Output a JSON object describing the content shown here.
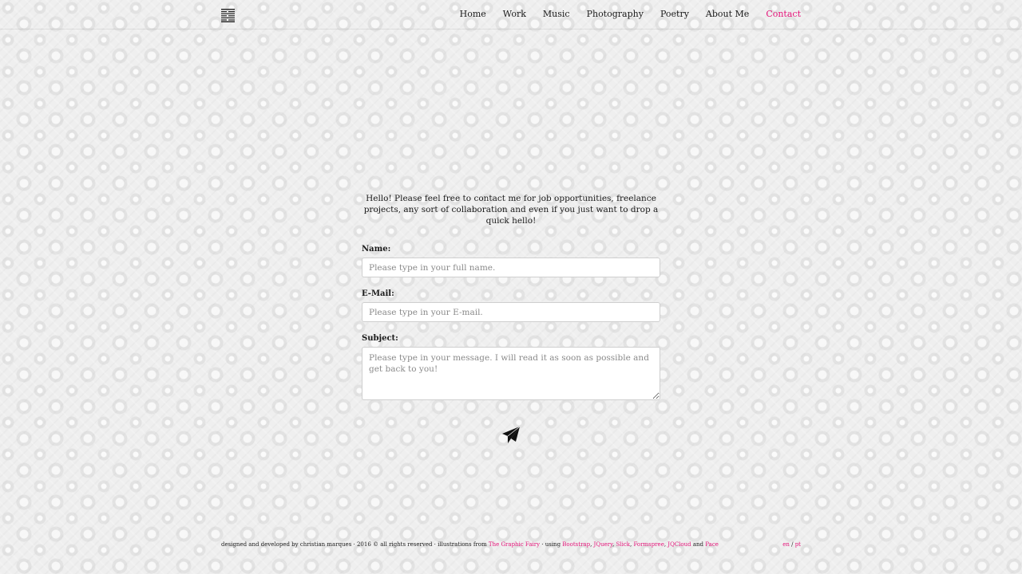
{
  "colors": {
    "accent": "#e5157a",
    "text": "#1a1a1a",
    "background": "#efefef"
  },
  "header": {
    "logo_icon": "menu-lines-logo-icon",
    "nav": [
      {
        "label": "Home",
        "active": false
      },
      {
        "label": "Work",
        "active": false
      },
      {
        "label": "Music",
        "active": false
      },
      {
        "label": "Photography",
        "active": false
      },
      {
        "label": "Poetry",
        "active": false
      },
      {
        "label": "About Me",
        "active": false
      },
      {
        "label": "Contact",
        "active": true
      }
    ]
  },
  "contact": {
    "intro": "Hello! Please feel free to contact me for job opportunities, freelance projects, any sort of collaboration and even if you just want to drop a quick hello!",
    "name_label": "Name:",
    "name_placeholder": "Please type in your full name.",
    "email_label": "E-Mail:",
    "email_placeholder": "Please type in your E-mail.",
    "subject_label": "Subject:",
    "subject_placeholder": "Please type in your message. I will read it as soon as possible and get back to you!",
    "send_icon": "paper-plane-icon"
  },
  "footer": {
    "credit_text": "designed and developed by christian marques · 2016 © all rights reserved · illustrations from",
    "illustrations_link": "The Graphic Fairy",
    "using_text": "· using",
    "tools": [
      "Bootstrap",
      "JQuery",
      "Slick",
      "Formspree",
      "JQCloud"
    ],
    "and_text": "and",
    "last_tool": "Pace",
    "lang_en": "en",
    "lang_sep": "/",
    "lang_pt": "pt"
  }
}
